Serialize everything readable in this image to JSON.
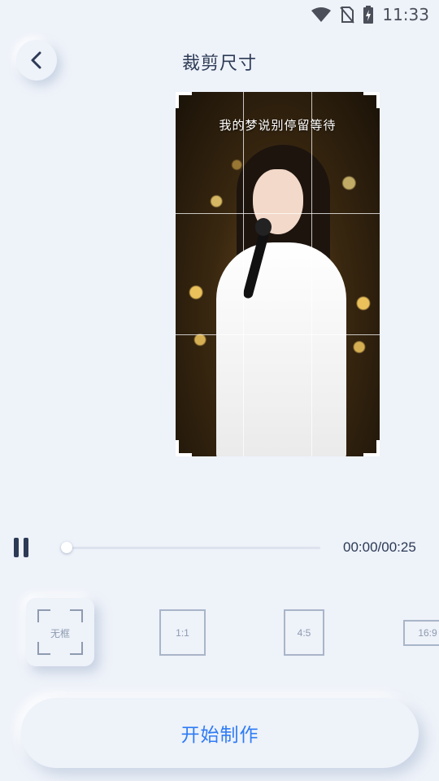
{
  "status_bar": {
    "time": "11:33",
    "icons": [
      "wifi-icon",
      "no-sim-icon",
      "battery-charging-icon"
    ]
  },
  "header": {
    "back_icon": "chevron-left-icon",
    "title": "裁剪尺寸"
  },
  "preview": {
    "lyric": "我的梦说别停留等待"
  },
  "player": {
    "state_icon": "pause-icon",
    "progress": 0,
    "time": "00:00/00:25"
  },
  "ratios": [
    {
      "label": "无框",
      "selected": true
    },
    {
      "label": "1:1",
      "selected": false
    },
    {
      "label": "4:5",
      "selected": false
    },
    {
      "label": "16:9",
      "selected": false
    }
  ],
  "start_button": {
    "label": "开始制作"
  },
  "colors": {
    "background": "#eef2f9",
    "accent": "#2f7cf6",
    "text": "#2c3a55"
  }
}
